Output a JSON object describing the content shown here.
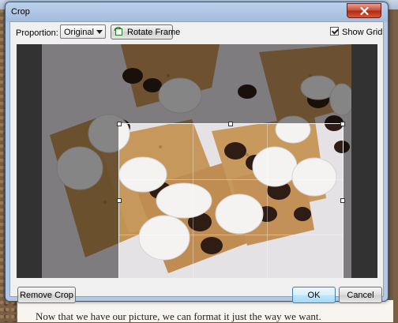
{
  "background": {
    "document_text": "Now that we have our picture, we can format it just the way we want."
  },
  "dialog": {
    "title": "Crop",
    "close_icon": "close-icon",
    "toolbar": {
      "proportion_label": "Proportion:",
      "proportion_value": "Original",
      "rotate_label": "Rotate Frame",
      "rotate_icon": "rotate-frame-icon",
      "show_grid_label": "Show Grid",
      "show_grid_checked": true
    },
    "image": {
      "description_icon": "photo-smores"
    },
    "buttons": {
      "remove_crop": "Remove Crop",
      "ok": "OK",
      "cancel": "Cancel"
    }
  },
  "colors": {
    "title_bar": "#b3c7e3",
    "close_button": "#c9472f",
    "default_button_border": "#3c7fb1"
  }
}
